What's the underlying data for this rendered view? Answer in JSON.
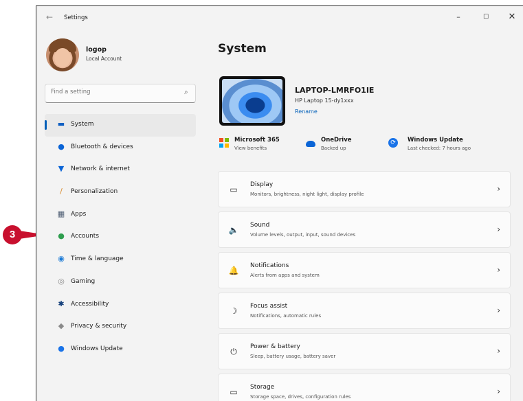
{
  "window": {
    "title": "Settings",
    "back_glyph": "←",
    "controls": {
      "minimize": "–",
      "maximize": "☐",
      "close": "✕"
    }
  },
  "user": {
    "name": "logop",
    "account_type": "Local Account"
  },
  "search": {
    "placeholder": "Find a setting",
    "icon": "⌕"
  },
  "nav": {
    "items": [
      {
        "label": "System",
        "icon": "system-icon",
        "glyph": "▬",
        "color": "#0f5fc2",
        "active": true
      },
      {
        "label": "Bluetooth & devices",
        "icon": "bluetooth-icon",
        "glyph": "●",
        "color": "#0a64d6"
      },
      {
        "label": "Network & internet",
        "icon": "network-icon",
        "glyph": "▼",
        "color": "#0a64d6"
      },
      {
        "label": "Personalization",
        "icon": "brush-icon",
        "glyph": "/",
        "color": "#d98a2b"
      },
      {
        "label": "Apps",
        "icon": "apps-icon",
        "glyph": "▦",
        "color": "#4a5a70"
      },
      {
        "label": "Accounts",
        "icon": "accounts-icon",
        "glyph": "●",
        "color": "#2e9e4e"
      },
      {
        "label": "Time & language",
        "icon": "globe-icon",
        "glyph": "◉",
        "color": "#1a7ad6"
      },
      {
        "label": "Gaming",
        "icon": "gaming-icon",
        "glyph": "◎",
        "color": "#8a8a8a"
      },
      {
        "label": "Accessibility",
        "icon": "accessibility-icon",
        "glyph": "✱",
        "color": "#123e7a"
      },
      {
        "label": "Privacy & security",
        "icon": "shield-icon",
        "glyph": "◆",
        "color": "#8a8a8a"
      },
      {
        "label": "Windows Update",
        "icon": "update-icon",
        "glyph": "●",
        "color": "#1a73e8"
      }
    ]
  },
  "page": {
    "title": "System"
  },
  "device": {
    "name": "LAPTOP-LMRFO1IE",
    "model": "HP Laptop 15-dy1xxx",
    "rename_label": "Rename"
  },
  "quick": [
    {
      "title": "Microsoft 365",
      "subtitle": "View benefits",
      "icon": "microsoft-365-icon"
    },
    {
      "title": "OneDrive",
      "subtitle": "Backed up",
      "icon": "onedrive-icon"
    },
    {
      "title": "Windows Update",
      "subtitle": "Last checked: 7 hours ago",
      "icon": "windows-update-icon"
    }
  ],
  "cards": [
    {
      "title": "Display",
      "subtitle": "Monitors, brightness, night light, display profile",
      "icon": "display-icon",
      "glyph": "▭"
    },
    {
      "title": "Sound",
      "subtitle": "Volume levels, output, input, sound devices",
      "icon": "speaker-icon",
      "glyph": "🔈"
    },
    {
      "title": "Notifications",
      "subtitle": "Alerts from apps and system",
      "icon": "bell-icon",
      "glyph": "🔔"
    },
    {
      "title": "Focus assist",
      "subtitle": "Notifications, automatic rules",
      "icon": "moon-icon",
      "glyph": "☽"
    },
    {
      "title": "Power & battery",
      "subtitle": "Sleep, battery usage, battery saver",
      "icon": "power-icon",
      "glyph": "⏻"
    },
    {
      "title": "Storage",
      "subtitle": "Storage space, drives, configuration rules",
      "icon": "storage-icon",
      "glyph": "▭"
    }
  ],
  "chevron": "›",
  "callout": {
    "number": "3",
    "color": "#c8102e"
  },
  "colors": {
    "accent": "#005fb8",
    "window_bg": "#f3f3f3",
    "card_bg": "#fbfbfb"
  }
}
